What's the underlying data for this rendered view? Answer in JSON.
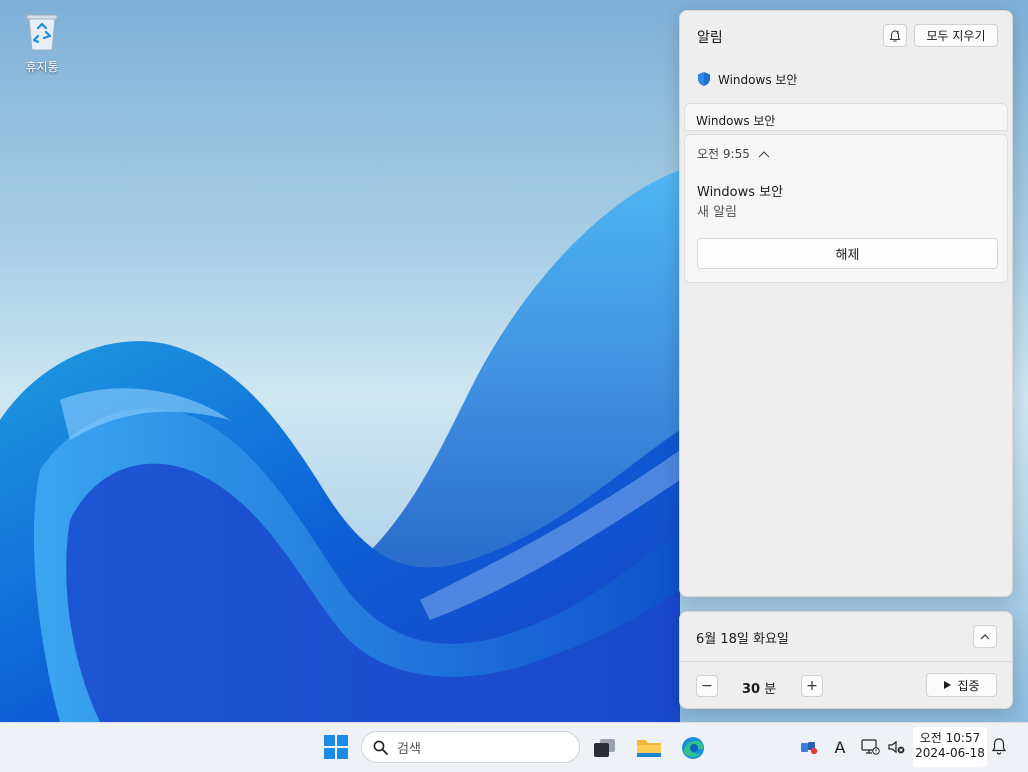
{
  "desktop": {
    "icons": [
      {
        "label": "휴지통",
        "icon": "recycle-bin-icon"
      }
    ]
  },
  "notification_center": {
    "title": "알림",
    "snooze_icon": "do-not-disturb-icon",
    "clear_all_label": "모두 지우기",
    "app_group": {
      "app_name": "Windows 보안",
      "icon": "shield-icon",
      "stacked_preview": "Windows 보안"
    },
    "notification": {
      "time": "오전 9:55",
      "title": "Windows 보안",
      "body": "새 알림",
      "dismiss_label": "해제"
    }
  },
  "calendar": {
    "date": "6월 18일 화요일",
    "focus_minutes": "30",
    "focus_unit": "분",
    "minus_label": "−",
    "plus_label": "+",
    "focus_label": "집중"
  },
  "taskbar": {
    "search_placeholder": "검색",
    "pinned": [
      "start-icon",
      "task-view-icon",
      "file-explorer-icon",
      "edge-icon"
    ],
    "tray": [
      "network-app-icon",
      "input-indicator",
      "display-icon",
      "volume-muted-icon"
    ],
    "input_indicator": "A",
    "clock": {
      "time": "오전 10:57",
      "date": "2024-06-18"
    }
  },
  "colors": {
    "accent": "#0078d4",
    "shield": "#1f6fd1",
    "panel_bg": "#eeeeee",
    "taskbar_bg": "#eef1f6"
  }
}
